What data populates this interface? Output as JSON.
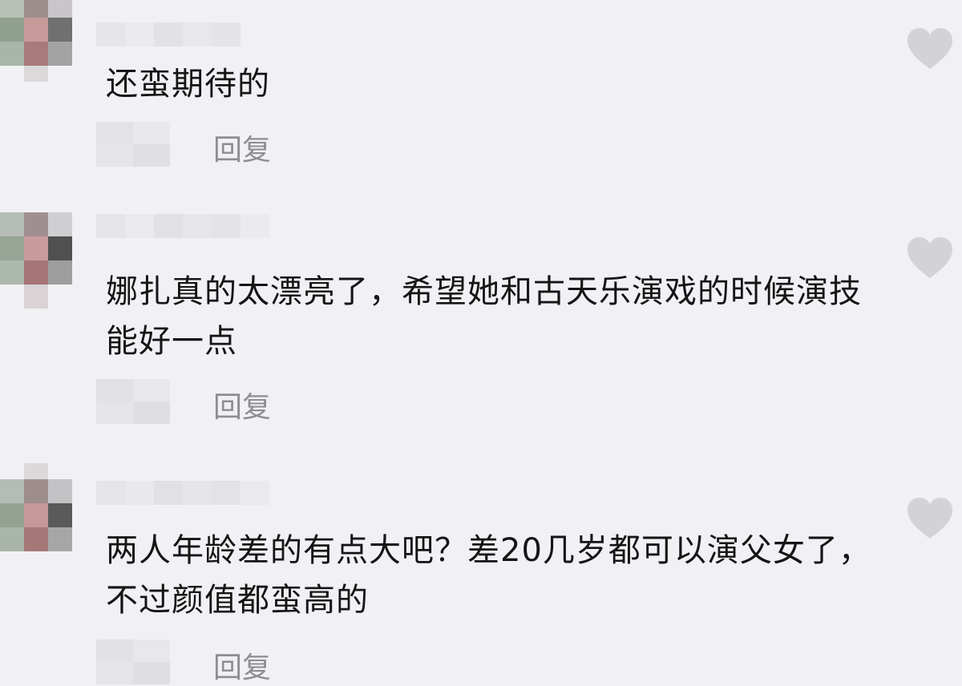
{
  "comments": [
    {
      "text": "还蛮期待的",
      "reply_label": "回复"
    },
    {
      "text": "娜扎真的太漂亮了，希望她和古天乐演戏的时候演技能好一点",
      "reply_label": "回复"
    },
    {
      "text": "两人年龄差的有点大吧？差20几岁都可以演父女了，不过颜值都蛮高的",
      "reply_label": "回复"
    }
  ],
  "colors": {
    "background": "#f1f0f4",
    "text": "#151515",
    "reply": "#8d8d92",
    "like_icon": "#d3d3d7"
  },
  "icons": {
    "like": "heart-icon"
  }
}
